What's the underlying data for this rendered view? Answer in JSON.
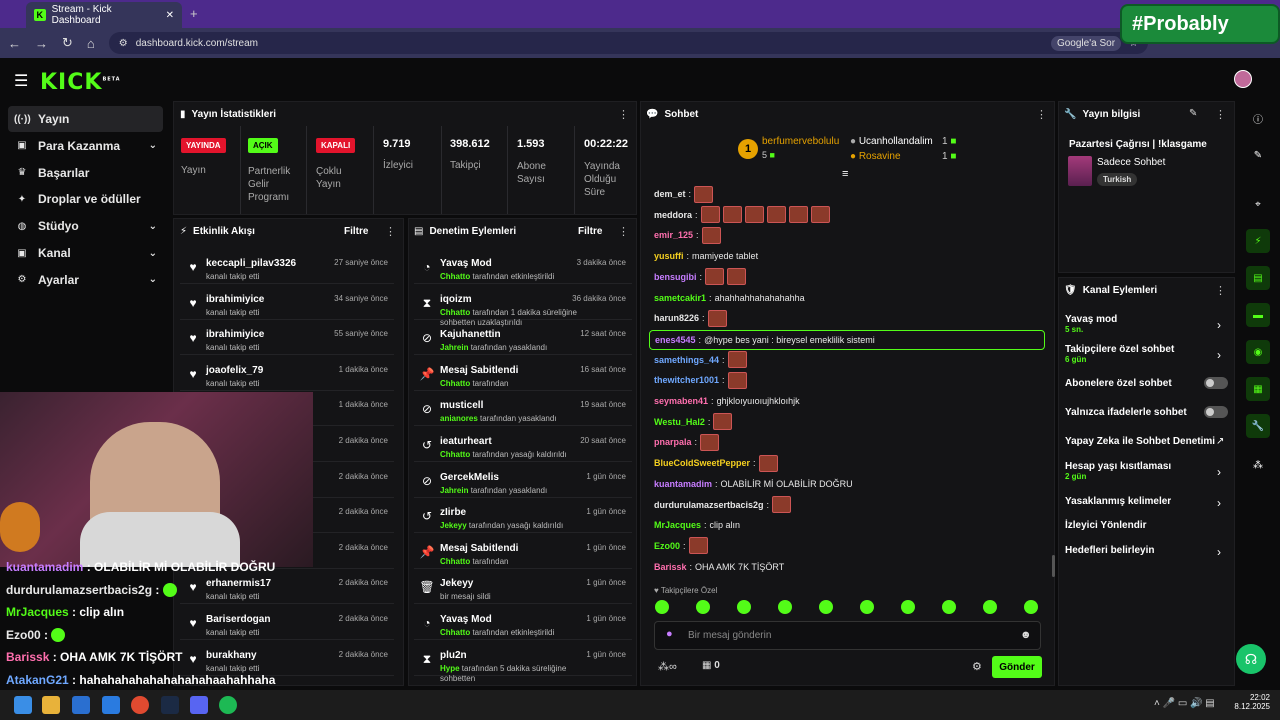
{
  "browser": {
    "tab_title": "Stream - Kick Dashboard",
    "url": "dashboard.kick.com/stream",
    "google_btn": "Google'a Sor",
    "overlay_brand": "#Probably"
  },
  "app": {
    "logo": "KICK",
    "logo_badge": "BETA"
  },
  "sidebar": [
    {
      "label": "Yayın",
      "icon": "broadcast-icon"
    },
    {
      "label": "Para Kazanma",
      "icon": "money-icon",
      "chev": true
    },
    {
      "label": "Başarılar",
      "icon": "trophy-icon"
    },
    {
      "label": "Droplar ve ödüller",
      "icon": "gift-icon"
    },
    {
      "label": "Stüdyo",
      "icon": "studio-icon",
      "chev": true
    },
    {
      "label": "Kanal",
      "icon": "channel-icon",
      "chev": true
    },
    {
      "label": "Ayarlar",
      "icon": "gear-icon",
      "chev": true
    }
  ],
  "stats": {
    "title": "Yayın İstatistikleri",
    "live_badge": "YAYINDA",
    "live_label": "Yayın",
    "partner_badge": "AÇIK",
    "partner_label": "Partnerlik Gelir Programı",
    "multi_badge": "KAPALI",
    "multi_label": "Çoklu Yayın",
    "viewers": "9.719",
    "viewers_label": "İzleyici",
    "followers": "398.612",
    "followers_label": "Takipçi",
    "subs": "1.593",
    "subs_label": "Abone Sayısı",
    "uptime": "00:22:22",
    "uptime_label": "Yayında Olduğu Süre"
  },
  "activity": {
    "title": "Etkinlik Akışı",
    "filter": "Filtre",
    "items": [
      {
        "user": "keccapli_pilav3326",
        "desc": "kanalı takip etti",
        "time": "27 saniye önce"
      },
      {
        "user": "ibrahimiyice",
        "desc": "kanalı takip etti",
        "time": "34 saniye önce"
      },
      {
        "user": "ibrahimiyice",
        "desc": "kanalı takip etti",
        "time": "55 saniye önce"
      },
      {
        "user": "joaofelix_79",
        "desc": "kanalı takip etti",
        "time": "1 dakika önce"
      },
      {
        "user": "",
        "desc": "",
        "time": "1 dakika önce"
      },
      {
        "user": "",
        "desc": "",
        "time": "2 dakika önce"
      },
      {
        "user": "",
        "desc": "",
        "time": "2 dakika önce"
      },
      {
        "user": "",
        "desc": "",
        "time": "2 dakika önce"
      },
      {
        "user": "",
        "desc": "",
        "time": "2 dakika önce"
      },
      {
        "user": "erhanermis17",
        "desc": "kanalı takip etti",
        "time": "2 dakika önce"
      },
      {
        "user": "Bariserdogan",
        "desc": "kanalı takip etti",
        "time": "2 dakika önce"
      },
      {
        "user": "burakhany",
        "desc": "kanalı takip etti",
        "time": "2 dakika önce"
      }
    ]
  },
  "moderation": {
    "title": "Denetim Eylemleri",
    "filter": "Filtre",
    "items": [
      {
        "icon": "slow-icon",
        "title": "Yavaş Mod",
        "by": "Chhatto",
        "desc": " tarafından etkinleştirildi",
        "time": "3 dakika önce"
      },
      {
        "icon": "hourglass-icon",
        "title": "iqoizm",
        "by": "Chhatto",
        "desc": " tarafından 1 dakika süreliğine sohbetten uzaklaştırıldı",
        "time": "36 dakika önce"
      },
      {
        "icon": "ban-icon",
        "title": "Kajuhanettin",
        "by": "Jahrein",
        "desc": " tarafından yasaklandı",
        "time": "12 saat önce"
      },
      {
        "icon": "pin-icon",
        "title": "Mesaj Sabitlendi",
        "by": "Chhatto",
        "desc": " tarafından",
        "time": "16 saat önce"
      },
      {
        "icon": "ban-icon",
        "title": "musticell",
        "by": "anianores",
        "desc": " tarafından yasaklandı",
        "time": "19 saat önce"
      },
      {
        "icon": "unban-icon",
        "title": "ieaturheart",
        "by": "Chhatto",
        "desc": " tarafından yasağı kaldırıldı",
        "time": "20 saat önce"
      },
      {
        "icon": "ban-icon",
        "title": "GercekMelis",
        "by": "Jahrein",
        "desc": " tarafından yasaklandı",
        "time": "1 gün önce"
      },
      {
        "icon": "unban-icon",
        "title": "zIirbe",
        "by": "Jekeyy",
        "desc": " tarafından yasağı kaldırıldı",
        "time": "1 gün önce"
      },
      {
        "icon": "pin-icon",
        "title": "Mesaj Sabitlendi",
        "by": "Chhatto",
        "desc": " tarafından",
        "time": "1 gün önce"
      },
      {
        "icon": "trash-icon",
        "title": "Jekeyy",
        "by": "",
        "desc": "bir mesajı sildi",
        "time": "1 gün önce"
      },
      {
        "icon": "slow-icon",
        "title": "Yavaş Mod",
        "by": "Chhatto",
        "desc": " tarafından etkinleştirildi",
        "time": "1 gün önce"
      },
      {
        "icon": "hourglass-icon",
        "title": "plu2n",
        "by": "Hype",
        "desc": " tarafından 5 dakika süreliğine sohbetten",
        "time": "1 gün önce"
      }
    ]
  },
  "chat": {
    "title": "Sohbet",
    "top_gifter": {
      "name": "berfumervebolulu",
      "count": "5"
    },
    "gifters": [
      {
        "name": "Ucanhollandalim",
        "count": "1"
      },
      {
        "name": "Rosavine",
        "count": "1"
      }
    ],
    "messages": [
      {
        "user": "dem_et",
        "color": "#e8e8e8",
        "text": "",
        "emotes": 1
      },
      {
        "user": "meddora",
        "color": "#e8e8e8",
        "text": "",
        "emotes": 6
      },
      {
        "user": "emir_125",
        "color": "#ff6fae",
        "text": "",
        "emotes": 1
      },
      {
        "user": "yusuffi",
        "color": "#f5d020",
        "text": "mamiyede tablet",
        "emotes": 0
      },
      {
        "user": "bensugibi",
        "color": "#c77dff",
        "text": "",
        "emotes": 2
      },
      {
        "user": "sametcakir1",
        "color": "#53fc18",
        "text": "ahahhahhahahahahha",
        "emotes": 0
      },
      {
        "user": "harun8226",
        "color": "#e8e8e8",
        "text": "",
        "emotes": 1
      },
      {
        "user": "enes4545",
        "color": "#c77dff",
        "text": "@hype bes yani : bireysel emeklilik sistemi",
        "emotes": 0
      },
      {
        "user": "samethings_44",
        "color": "#6fa8ff",
        "text": "",
        "emotes": 1
      },
      {
        "user": "thewitcher1001",
        "color": "#6fa8ff",
        "text": "",
        "emotes": 1
      },
      {
        "user": "seymaben41",
        "color": "#ff6fae",
        "text": "ghjklоıyuıoıujhklоıhjk",
        "emotes": 0
      },
      {
        "user": "Westu_Hal2",
        "color": "#53fc18",
        "text": "",
        "emotes": 1
      },
      {
        "user": "pnarpala",
        "color": "#ff6fae",
        "text": "",
        "emotes": 1
      },
      {
        "user": "BlueColdSweetPepper",
        "color": "#f5d020",
        "text": "",
        "emotes": 1
      },
      {
        "user": "kuantamadim",
        "color": "#c77dff",
        "text": "OLABİLİR Mİ OLABİLİR DOĞRU",
        "emotes": 0
      },
      {
        "user": "durdurulamazsertbacis2g",
        "color": "#e8e8e8",
        "text": "",
        "emotes": 1
      },
      {
        "user": "MrJacques",
        "color": "#53fc18",
        "text": "clip alın",
        "emotes": 0
      },
      {
        "user": "Ezo00",
        "color": "#53fc18",
        "text": "",
        "emotes": 1
      },
      {
        "user": "Barissk",
        "color": "#ff6fae",
        "text": "OHA AMK 7K TİŞÖRT",
        "emotes": 0
      }
    ],
    "emote_bar_label": "Takipçilere Özel",
    "input_placeholder": "Bir mesaj gönderin",
    "points": "0",
    "send_label": "Gönder"
  },
  "stream_info": {
    "title": "Yayın bilgisi",
    "stream_title": "Pazartesi Çağrısı | !klasgame",
    "category": "Sadece Sohbet",
    "tag": "Turkish"
  },
  "channel_actions": {
    "title": "Kanal Eylemleri",
    "items": [
      {
        "label": "Yavaş mod",
        "sub": "5 sn.",
        "type": "chevron"
      },
      {
        "label": "Takipçilere özel sohbet",
        "sub": "6 gün",
        "type": "chevron"
      },
      {
        "label": "Abonelere özel sohbet",
        "sub": "",
        "type": "toggle"
      },
      {
        "label": "Yalnızca ifadelerle sohbet",
        "sub": "",
        "type": "toggle"
      },
      {
        "label": "Yapay Zeka ile Sohbet Denetimi",
        "sub": "",
        "type": "external"
      },
      {
        "label": "Hesap yaşı kısıtlaması",
        "sub": "2 gün",
        "type": "chevron"
      },
      {
        "label": "Yasaklanmış kelimeler",
        "sub": "",
        "type": "chevron"
      },
      {
        "label": "İzleyici Yönlendir",
        "sub": "",
        "type": "none"
      },
      {
        "label": "Hedefleri belirleyin",
        "sub": "",
        "type": "chevron"
      }
    ]
  },
  "overlay_chat": [
    {
      "user": "kuantamadim",
      "text": "OLABİLİR Mİ OLABİLİR DOĞRU",
      "color": "#c77dff"
    },
    {
      "user": "durdurulamazsertbacis2g",
      "text": "",
      "color": "#e8e8e8"
    },
    {
      "user": "MrJacques",
      "text": "clip alın",
      "color": "#53fc18"
    },
    {
      "user": "Ezo00",
      "text": "",
      "color": "#e8e8e8"
    },
    {
      "user": "Barissk",
      "text": "OHA AMK 7K TİŞÖRT",
      "color": "#ff6fae"
    },
    {
      "user": "AtakanG21",
      "text": "hahahahahahahahahahaahahhaha",
      "color": "#6fa8ff"
    }
  ],
  "taskbar": {
    "time": "22:02",
    "date": "8.12.2025"
  }
}
